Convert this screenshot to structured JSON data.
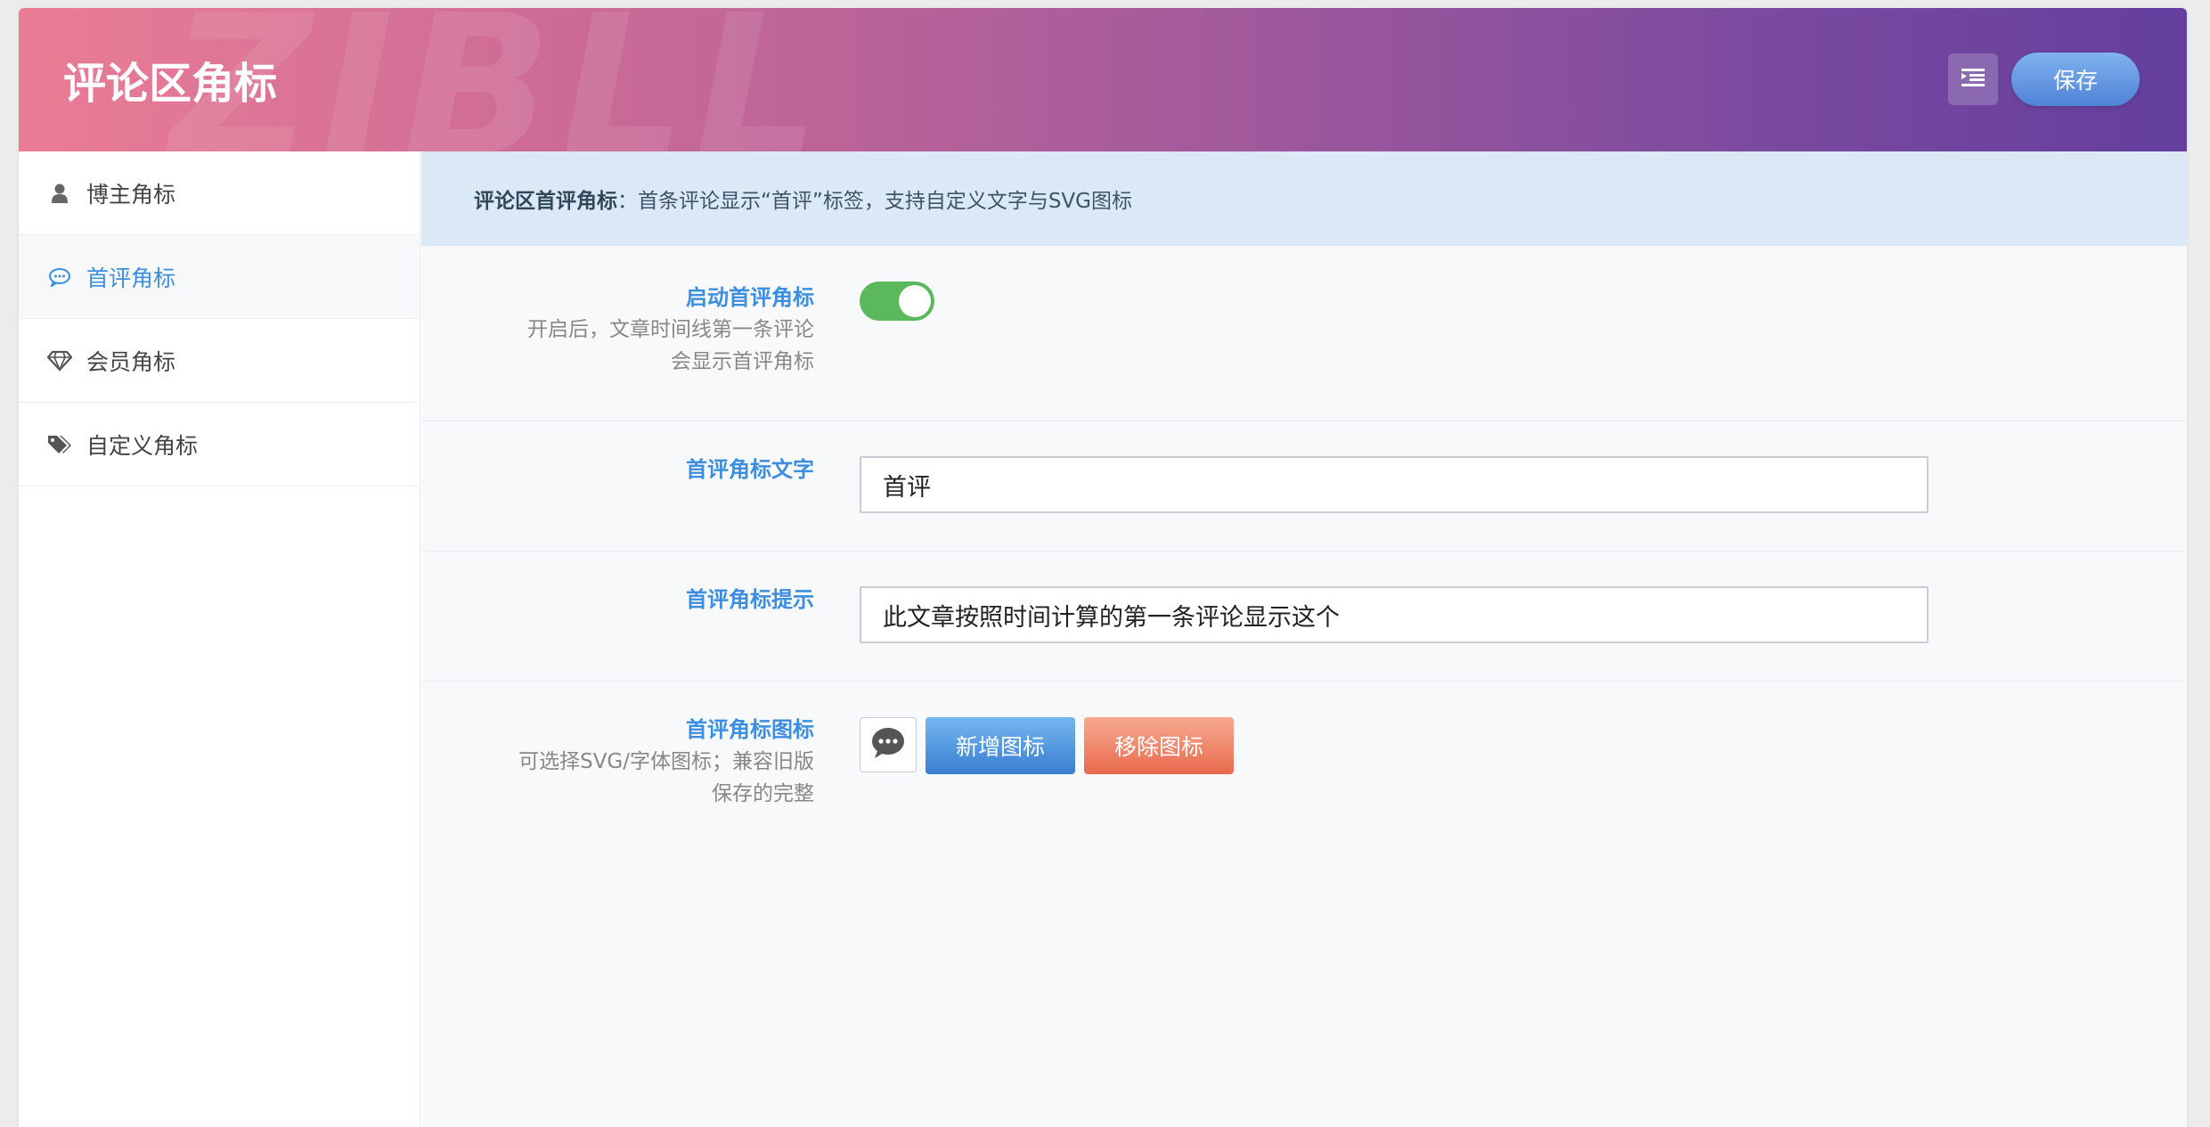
{
  "header": {
    "title": "评论区角标",
    "watermark": "ZIBLL",
    "save_label": "保存"
  },
  "sidebar": {
    "items": [
      {
        "label": "博主角标",
        "icon": "user-icon"
      },
      {
        "label": "首评角标",
        "icon": "comment-icon",
        "active": true
      },
      {
        "label": "会员角标",
        "icon": "diamond-icon"
      },
      {
        "label": "自定义角标",
        "icon": "tags-icon"
      }
    ]
  },
  "notice": {
    "title": "评论区首评角标",
    "text": "：首条评论显示“首评”标签，支持自定义文字与SVG图标"
  },
  "fields": {
    "enable": {
      "label": "启动首评角标",
      "desc_line1": "开启后，文章时间线第一条评论",
      "desc_line2": "会显示首评角标",
      "value": true
    },
    "text": {
      "label": "首评角标文字",
      "value": "首评"
    },
    "tip": {
      "label": "首评角标提示",
      "value": "此文章按照时间计算的第一条评论显示这个"
    },
    "icon": {
      "label": "首评角标图标",
      "desc_line1": "可选择SVG/字体图标；兼容旧版",
      "desc_line2": "保存的完整",
      "add_label": "新增图标",
      "remove_label": "移除图标"
    }
  },
  "colors": {
    "accent": "#3c8ee0",
    "toggle_on": "#5cb85c",
    "remove": "#e96a4f"
  }
}
